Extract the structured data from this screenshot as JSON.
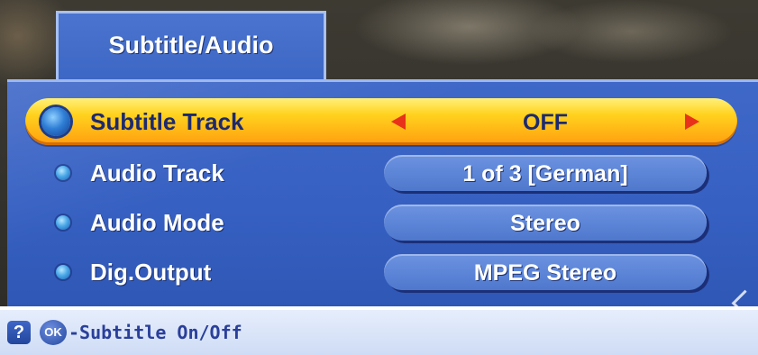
{
  "menu": {
    "title": "Subtitle/Audio",
    "items": [
      {
        "label": "Subtitle Track",
        "value": "OFF",
        "selected": true
      },
      {
        "label": "Audio Track",
        "value": "1 of 3 [German]",
        "selected": false
      },
      {
        "label": "Audio Mode",
        "value": "Stereo",
        "selected": false
      },
      {
        "label": "Dig.Output",
        "value": "MPEG Stereo",
        "selected": false
      }
    ]
  },
  "footer": {
    "help_icon": "?",
    "ok_icon": "OK",
    "hint": "-Subtitle On/Off"
  },
  "colors": {
    "panel": "#3660c2",
    "selected_row": "#ffd21e",
    "arrow": "#e8321a",
    "footer": "#e6eefc"
  }
}
